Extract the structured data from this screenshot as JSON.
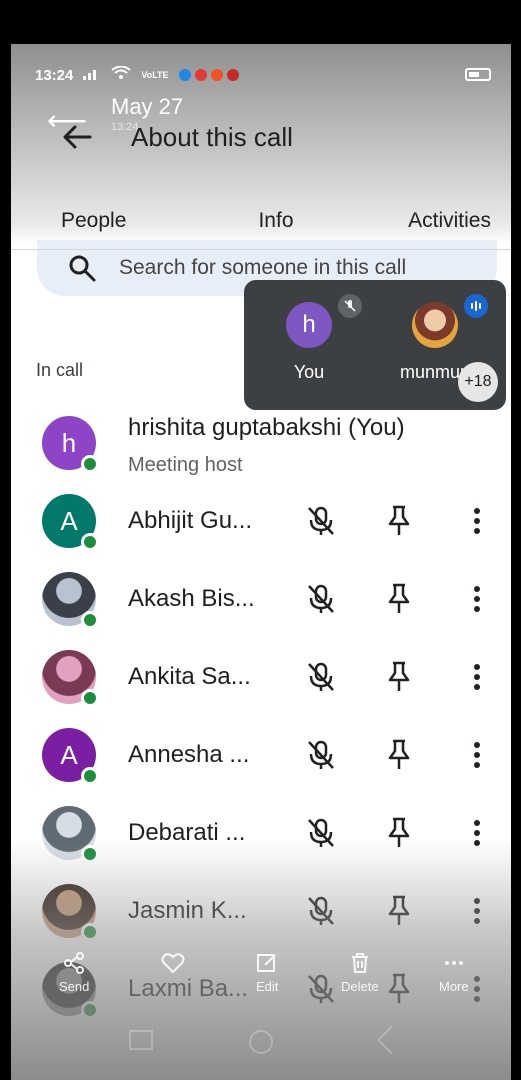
{
  "status_bar": {
    "time": "13:24",
    "network": "VoLTE",
    "app_dot_colors": [
      "#1e88e5",
      "#e53935",
      "#f4511e",
      "#c62828"
    ]
  },
  "ghost_overlay": {
    "date": "May 27",
    "time": "13:24"
  },
  "appbar": {
    "title": "About this call"
  },
  "tabs": [
    {
      "label": "People",
      "active": true
    },
    {
      "label": "Info",
      "active": false
    },
    {
      "label": "Activities",
      "active": false
    }
  ],
  "search": {
    "placeholder": "Search for someone in this call"
  },
  "pip": {
    "tiles": [
      {
        "name": "You",
        "initial": "h",
        "color": "#7e57c2",
        "badge": "muted"
      },
      {
        "name": "munmun",
        "initial": "",
        "color": "#c98a5a",
        "badge": "speaking"
      }
    ],
    "more_count": "+18"
  },
  "section_label": "In call",
  "host": {
    "name": "hrishita guptabakshi (You)",
    "role": "Meeting host",
    "initial": "h",
    "color": "#8e44c6"
  },
  "participants": [
    {
      "name": "Abhijit Gu...",
      "initial": "A",
      "color": "#00796b",
      "photo": false
    },
    {
      "name": "Akash Bis...",
      "initial": "",
      "color": "#6b6b6b",
      "photo": true,
      "photo_colors": [
        "#b9c3cf",
        "#3a3f4a"
      ]
    },
    {
      "name": "Ankita Sa...",
      "initial": "",
      "color": "#b24b7a",
      "photo": true,
      "photo_colors": [
        "#e0a2c0",
        "#7a3a55"
      ]
    },
    {
      "name": "Annesha ...",
      "initial": "A",
      "color": "#7b1fa2",
      "photo": false
    },
    {
      "name": "Debarati ...",
      "initial": "",
      "color": "#9fa8b2",
      "photo": true,
      "photo_colors": [
        "#d6dde4",
        "#5f6a73"
      ]
    },
    {
      "name": "Jasmin K...",
      "initial": "",
      "color": "#6b4a3a",
      "photo": true,
      "photo_colors": [
        "#c49a7b",
        "#3a2a22"
      ]
    },
    {
      "name": "Laxmi Ba...",
      "initial": "",
      "color": "#3a3a3a",
      "photo": true,
      "photo_colors": [
        "#8a8a8a",
        "#1e1e1e"
      ]
    }
  ],
  "overlay_actions": [
    {
      "label": "Send",
      "icon": "share-icon"
    },
    {
      "label": "",
      "icon": "heart-icon"
    },
    {
      "label": "Edit",
      "icon": "edit-icon"
    },
    {
      "label": "Delete",
      "icon": "trash-icon"
    },
    {
      "label": "More",
      "icon": "more-dots-icon"
    }
  ]
}
